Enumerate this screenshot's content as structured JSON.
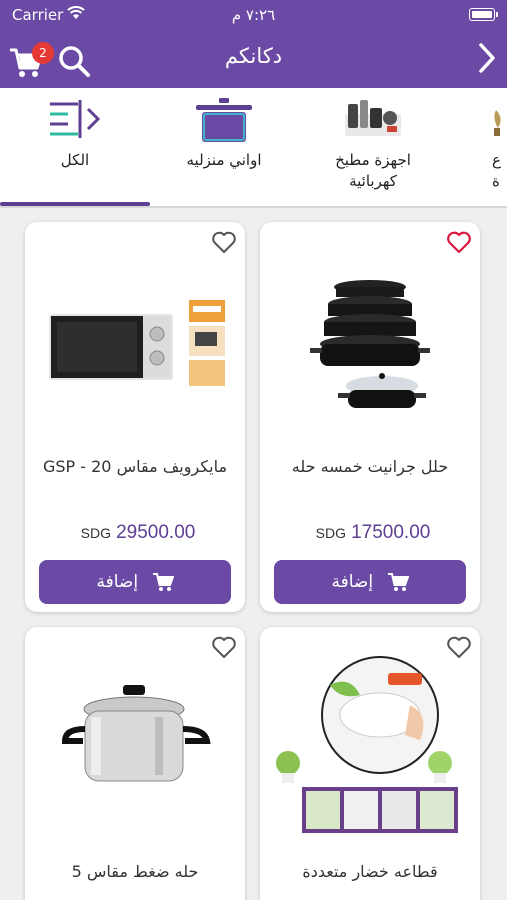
{
  "status_bar": {
    "carrier": "Carrier",
    "time": "٧:٢٦ م"
  },
  "navbar": {
    "title": "دكانكم",
    "cart_count": "2"
  },
  "categories": [
    {
      "label": "الكل",
      "icon": "menu-arrow-icon"
    },
    {
      "label": "اواني منزليه",
      "icon": "pot-icon"
    },
    {
      "label": "اجهزة مطبخ\nكهربائية",
      "icon": "kitchen-appliances-icon"
    },
    {
      "label": "ع\nة",
      "icon": "partial-category-icon"
    }
  ],
  "products": [
    {
      "name": "حلل جرانيت خمسه حله",
      "price": "17500.00",
      "currency": "SDG",
      "add_label": "إضافة",
      "favorited": true,
      "image": "cookware-set"
    },
    {
      "name": "مايكرويف مقاس 20 - GSP",
      "price": "29500.00",
      "currency": "SDG",
      "add_label": "إضافة",
      "favorited": false,
      "image": "microwave"
    },
    {
      "name": "قطاعه خضار متعددة",
      "price": "",
      "currency": "",
      "add_label": "",
      "favorited": false,
      "image": "vegetable-cutter"
    },
    {
      "name": "حله ضغط مقاس 5",
      "price": "",
      "currency": "",
      "add_label": "",
      "favorited": false,
      "image": "pressure-cooker"
    }
  ],
  "colors": {
    "brand": "#6a4aa5",
    "indicator": "#5d3f93",
    "badge": "#e53935",
    "favorite": "#d81b3c"
  }
}
